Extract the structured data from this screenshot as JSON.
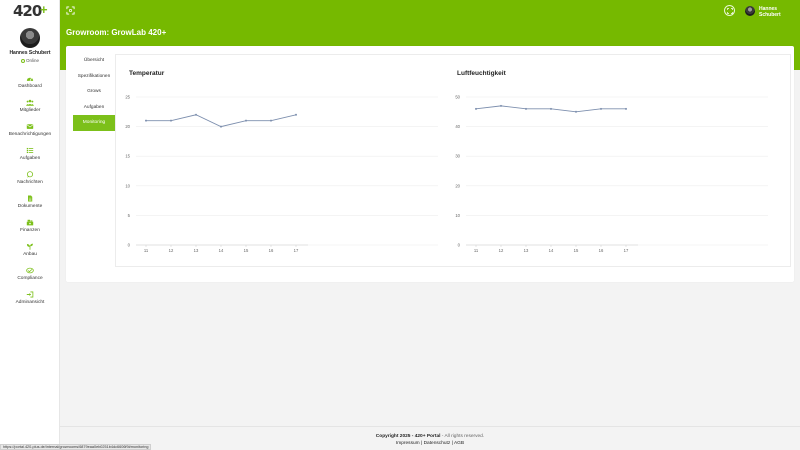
{
  "brand": {
    "logo_text": "420",
    "logo_plus": "+",
    "accent": "#76b900"
  },
  "user": {
    "name": "Hannes Schubert",
    "status": "Online"
  },
  "nav": [
    {
      "key": "dashboard",
      "label": "Dashboard",
      "icon": "gauge-icon"
    },
    {
      "key": "mitglieder",
      "label": "Mitglieder",
      "icon": "users-icon"
    },
    {
      "key": "benachrichtigungen",
      "label": "Benachrichtigungen",
      "icon": "envelope-icon"
    },
    {
      "key": "aufgaben",
      "label": "Aufgaben",
      "icon": "tasks-icon"
    },
    {
      "key": "nachrichten",
      "label": "Nachrichten",
      "icon": "chat-icon"
    },
    {
      "key": "dokumente",
      "label": "Dokumente",
      "icon": "document-icon"
    },
    {
      "key": "finanzen",
      "label": "Finanzen",
      "icon": "money-icon"
    },
    {
      "key": "anbau",
      "label": "Anbau",
      "icon": "seedling-icon"
    },
    {
      "key": "compliance",
      "label": "Compliance",
      "icon": "handshake-icon"
    },
    {
      "key": "adminansicht",
      "label": "Adminansicht",
      "icon": "sign-in-icon"
    }
  ],
  "header": {
    "page_title": "Growroom: GrowLab 420+",
    "user_name": "Hannes Schubert"
  },
  "tabs": [
    {
      "label": "Übersicht",
      "active": false
    },
    {
      "label": "Spezifikationen",
      "active": false
    },
    {
      "label": "Grows",
      "active": false
    },
    {
      "label": "Aufgaben",
      "active": false
    },
    {
      "label": "Monitoring",
      "active": true
    }
  ],
  "chart_data": [
    {
      "type": "line",
      "title": "Temperatur",
      "x": [
        11,
        12,
        13,
        14,
        15,
        16,
        17
      ],
      "series": [
        {
          "values": [
            21,
            21,
            22,
            20,
            21,
            21,
            22
          ]
        }
      ],
      "ylim": [
        0,
        25
      ],
      "yticks": [
        0,
        5,
        10,
        15,
        20,
        25
      ],
      "grid": true,
      "color": "#7d8fae"
    },
    {
      "type": "line",
      "title": "Luftfeuchtigkeit",
      "x": [
        11,
        12,
        13,
        14,
        15,
        16,
        17
      ],
      "series": [
        {
          "values": [
            46,
            47,
            46,
            46,
            45,
            46,
            46
          ]
        }
      ],
      "ylim": [
        0,
        50
      ],
      "yticks": [
        0,
        10,
        20,
        30,
        40,
        50
      ],
      "grid": true,
      "color": "#7d8fae"
    }
  ],
  "footer": {
    "copyright": "Copyright 2025 - 420+ Portal",
    "rights": " - All rights reserved.",
    "links": [
      "Impressum",
      "Datenschutz",
      "AGB"
    ],
    "separator": "|"
  },
  "status_url": "https://portal.420-plus.de/internal/growrooms/6879eaa0eb0251b4dc6606f9#monitoring"
}
